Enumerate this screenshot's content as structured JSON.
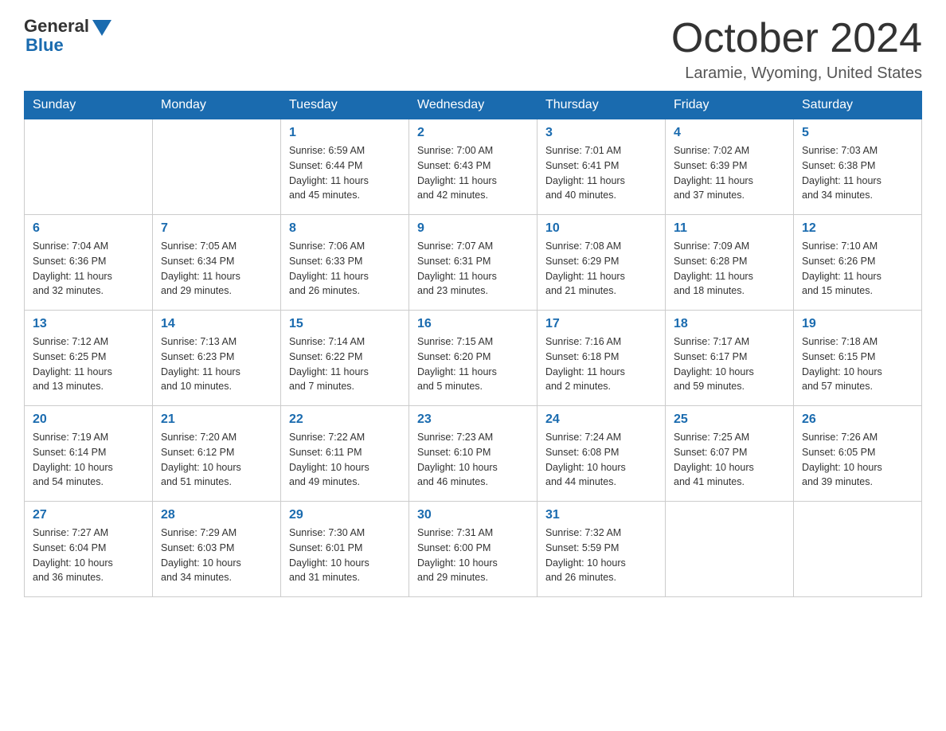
{
  "header": {
    "logo_general": "General",
    "logo_blue": "Blue",
    "month_title": "October 2024",
    "location": "Laramie, Wyoming, United States"
  },
  "days_of_week": [
    "Sunday",
    "Monday",
    "Tuesday",
    "Wednesday",
    "Thursday",
    "Friday",
    "Saturday"
  ],
  "weeks": [
    [
      {
        "day": "",
        "info": ""
      },
      {
        "day": "",
        "info": ""
      },
      {
        "day": "1",
        "info": "Sunrise: 6:59 AM\nSunset: 6:44 PM\nDaylight: 11 hours\nand 45 minutes."
      },
      {
        "day": "2",
        "info": "Sunrise: 7:00 AM\nSunset: 6:43 PM\nDaylight: 11 hours\nand 42 minutes."
      },
      {
        "day": "3",
        "info": "Sunrise: 7:01 AM\nSunset: 6:41 PM\nDaylight: 11 hours\nand 40 minutes."
      },
      {
        "day": "4",
        "info": "Sunrise: 7:02 AM\nSunset: 6:39 PM\nDaylight: 11 hours\nand 37 minutes."
      },
      {
        "day": "5",
        "info": "Sunrise: 7:03 AM\nSunset: 6:38 PM\nDaylight: 11 hours\nand 34 minutes."
      }
    ],
    [
      {
        "day": "6",
        "info": "Sunrise: 7:04 AM\nSunset: 6:36 PM\nDaylight: 11 hours\nand 32 minutes."
      },
      {
        "day": "7",
        "info": "Sunrise: 7:05 AM\nSunset: 6:34 PM\nDaylight: 11 hours\nand 29 minutes."
      },
      {
        "day": "8",
        "info": "Sunrise: 7:06 AM\nSunset: 6:33 PM\nDaylight: 11 hours\nand 26 minutes."
      },
      {
        "day": "9",
        "info": "Sunrise: 7:07 AM\nSunset: 6:31 PM\nDaylight: 11 hours\nand 23 minutes."
      },
      {
        "day": "10",
        "info": "Sunrise: 7:08 AM\nSunset: 6:29 PM\nDaylight: 11 hours\nand 21 minutes."
      },
      {
        "day": "11",
        "info": "Sunrise: 7:09 AM\nSunset: 6:28 PM\nDaylight: 11 hours\nand 18 minutes."
      },
      {
        "day": "12",
        "info": "Sunrise: 7:10 AM\nSunset: 6:26 PM\nDaylight: 11 hours\nand 15 minutes."
      }
    ],
    [
      {
        "day": "13",
        "info": "Sunrise: 7:12 AM\nSunset: 6:25 PM\nDaylight: 11 hours\nand 13 minutes."
      },
      {
        "day": "14",
        "info": "Sunrise: 7:13 AM\nSunset: 6:23 PM\nDaylight: 11 hours\nand 10 minutes."
      },
      {
        "day": "15",
        "info": "Sunrise: 7:14 AM\nSunset: 6:22 PM\nDaylight: 11 hours\nand 7 minutes."
      },
      {
        "day": "16",
        "info": "Sunrise: 7:15 AM\nSunset: 6:20 PM\nDaylight: 11 hours\nand 5 minutes."
      },
      {
        "day": "17",
        "info": "Sunrise: 7:16 AM\nSunset: 6:18 PM\nDaylight: 11 hours\nand 2 minutes."
      },
      {
        "day": "18",
        "info": "Sunrise: 7:17 AM\nSunset: 6:17 PM\nDaylight: 10 hours\nand 59 minutes."
      },
      {
        "day": "19",
        "info": "Sunrise: 7:18 AM\nSunset: 6:15 PM\nDaylight: 10 hours\nand 57 minutes."
      }
    ],
    [
      {
        "day": "20",
        "info": "Sunrise: 7:19 AM\nSunset: 6:14 PM\nDaylight: 10 hours\nand 54 minutes."
      },
      {
        "day": "21",
        "info": "Sunrise: 7:20 AM\nSunset: 6:12 PM\nDaylight: 10 hours\nand 51 minutes."
      },
      {
        "day": "22",
        "info": "Sunrise: 7:22 AM\nSunset: 6:11 PM\nDaylight: 10 hours\nand 49 minutes."
      },
      {
        "day": "23",
        "info": "Sunrise: 7:23 AM\nSunset: 6:10 PM\nDaylight: 10 hours\nand 46 minutes."
      },
      {
        "day": "24",
        "info": "Sunrise: 7:24 AM\nSunset: 6:08 PM\nDaylight: 10 hours\nand 44 minutes."
      },
      {
        "day": "25",
        "info": "Sunrise: 7:25 AM\nSunset: 6:07 PM\nDaylight: 10 hours\nand 41 minutes."
      },
      {
        "day": "26",
        "info": "Sunrise: 7:26 AM\nSunset: 6:05 PM\nDaylight: 10 hours\nand 39 minutes."
      }
    ],
    [
      {
        "day": "27",
        "info": "Sunrise: 7:27 AM\nSunset: 6:04 PM\nDaylight: 10 hours\nand 36 minutes."
      },
      {
        "day": "28",
        "info": "Sunrise: 7:29 AM\nSunset: 6:03 PM\nDaylight: 10 hours\nand 34 minutes."
      },
      {
        "day": "29",
        "info": "Sunrise: 7:30 AM\nSunset: 6:01 PM\nDaylight: 10 hours\nand 31 minutes."
      },
      {
        "day": "30",
        "info": "Sunrise: 7:31 AM\nSunset: 6:00 PM\nDaylight: 10 hours\nand 29 minutes."
      },
      {
        "day": "31",
        "info": "Sunrise: 7:32 AM\nSunset: 5:59 PM\nDaylight: 10 hours\nand 26 minutes."
      },
      {
        "day": "",
        "info": ""
      },
      {
        "day": "",
        "info": ""
      }
    ]
  ]
}
